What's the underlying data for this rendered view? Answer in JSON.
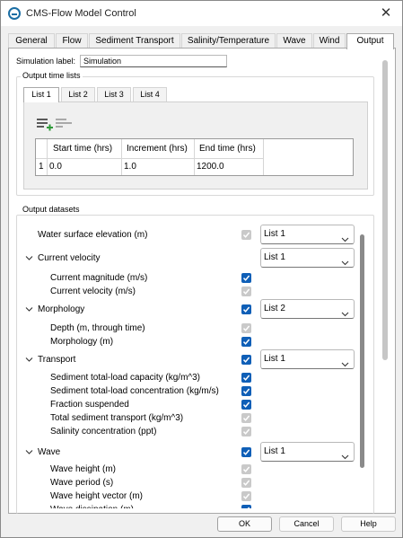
{
  "window": {
    "title": "CMS-Flow Model Control",
    "close_glyph": "✕"
  },
  "tabs": [
    "General",
    "Flow",
    "Sediment Transport",
    "Salinity/Temperature",
    "Wave",
    "Wind",
    "Output"
  ],
  "active_tab": "Output",
  "simulation_label": {
    "label": "Simulation label:",
    "value": "Simulation"
  },
  "output_time_lists": {
    "title": "Output time lists",
    "tabs": [
      "List 1",
      "List 2",
      "List 3",
      "List 4"
    ],
    "active_tab": "List 1",
    "table": {
      "headers": [
        "Start time (hrs)",
        "Increment (hrs)",
        "End time (hrs)"
      ],
      "rows": [
        {
          "index": "1",
          "start": "0.0",
          "increment": "1.0",
          "end": "1200.0"
        }
      ]
    }
  },
  "output_datasets": {
    "title": "Output datasets",
    "rows": [
      {
        "label": "Water surface elevation (m)",
        "level": 0,
        "expandable": false,
        "checkbox": "disabled",
        "list": "List 1"
      },
      {
        "label": "Current velocity",
        "level": 0,
        "expandable": true,
        "checkbox": "none",
        "list": "List 1"
      },
      {
        "label": "Current magnitude (m/s)",
        "level": 1,
        "checkbox": "checked"
      },
      {
        "label": "Current velocity (m/s)",
        "level": 1,
        "checkbox": "disabled"
      },
      {
        "label": "Morphology",
        "level": 0,
        "expandable": true,
        "checkbox": "checked",
        "list": "List 2"
      },
      {
        "label": "Depth (m, through time)",
        "level": 1,
        "checkbox": "disabled"
      },
      {
        "label": "Morphology (m)",
        "level": 1,
        "checkbox": "checked"
      },
      {
        "label": "Transport",
        "level": 0,
        "expandable": true,
        "checkbox": "checked",
        "list": "List 1"
      },
      {
        "label": "Sediment total-load capacity (kg/m^3)",
        "level": 1,
        "checkbox": "checked"
      },
      {
        "label": "Sediment total-load concentration (kg/m/s)",
        "level": 1,
        "checkbox": "checked"
      },
      {
        "label": "Fraction suspended",
        "level": 1,
        "checkbox": "checked"
      },
      {
        "label": "Total sediment transport (kg/m^3)",
        "level": 1,
        "checkbox": "disabled"
      },
      {
        "label": "Salinity concentration (ppt)",
        "level": 1,
        "checkbox": "disabled"
      },
      {
        "label": "Wave",
        "level": 0,
        "expandable": true,
        "checkbox": "checked",
        "list": "List 1"
      },
      {
        "label": "Wave height (m)",
        "level": 1,
        "checkbox": "disabled"
      },
      {
        "label": "Wave period (s)",
        "level": 1,
        "checkbox": "disabled"
      },
      {
        "label": "Wave height vector (m)",
        "level": 1,
        "checkbox": "disabled"
      },
      {
        "label": "Wave dissipation (m)",
        "level": 1,
        "checkbox": "checked"
      }
    ]
  },
  "buttons": {
    "ok": "OK",
    "cancel": "Cancel",
    "help": "Help"
  },
  "colors": {
    "accent": "#0f5fb7",
    "disabled_check": "#c9c9c9",
    "title_icon": "#1c6ea4"
  }
}
